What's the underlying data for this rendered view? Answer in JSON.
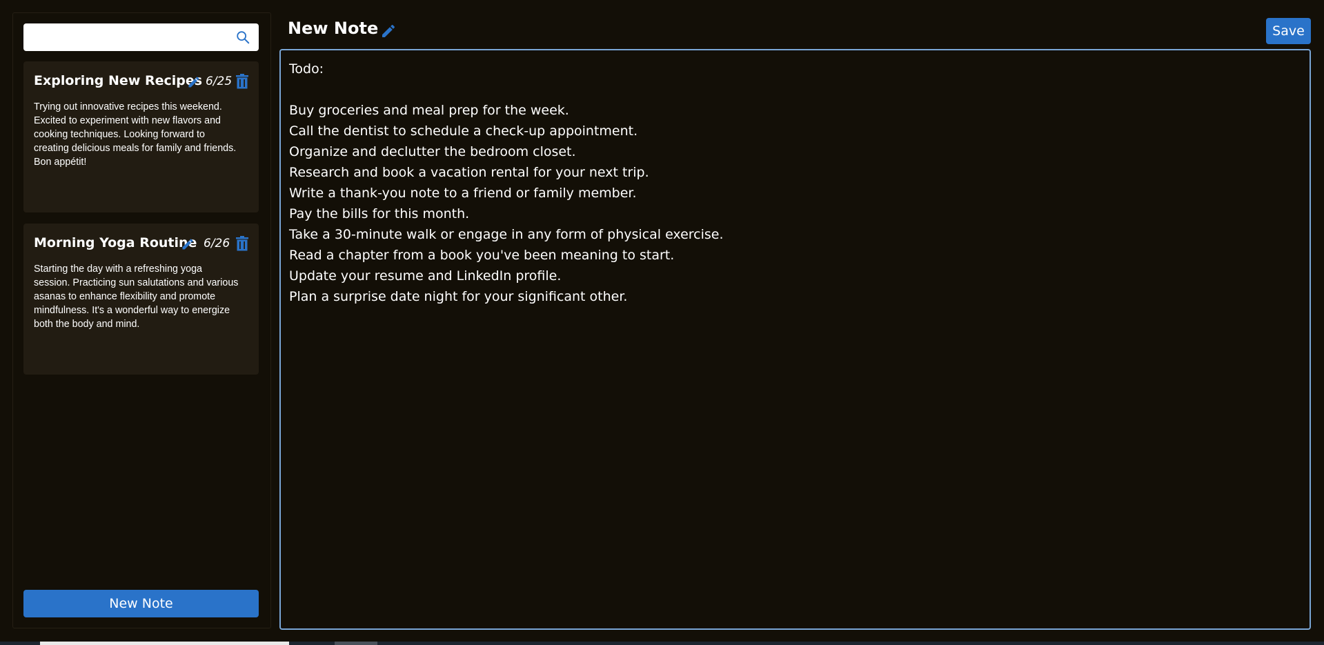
{
  "colors": {
    "background": "#130f07",
    "card": "#221c12",
    "accent": "#2a73c9",
    "editor_border": "#7aa6d6"
  },
  "sidebar": {
    "search": {
      "value": "",
      "placeholder": "",
      "icon": "search-icon"
    },
    "notes": [
      {
        "title": "Exploring New Recipes",
        "date": "6/25",
        "body": "Trying out innovative recipes this weekend. Excited to experiment with new flavors and cooking techniques. Looking forward to creating delicious meals for family and friends. Bon appétit!"
      },
      {
        "title": "Morning Yoga Routine",
        "date": "6/26",
        "body": "Starting the day with a refreshing yoga session. Practicing sun salutations and various asanas to enhance flexibility and promote mindfulness. It's a wonderful way to energize both the body and mind."
      }
    ],
    "new_note_label": "New Note"
  },
  "editor": {
    "title": "New Note",
    "save_label": "Save",
    "content": "Todo:\n\nBuy groceries and meal prep for the week.\nCall the dentist to schedule a check-up appointment.\nOrganize and declutter the bedroom closet.\nResearch and book a vacation rental for your next trip.\nWrite a thank-you note to a friend or family member.\nPay the bills for this month.\nTake a 30-minute walk or engage in any form of physical exercise.\nRead a chapter from a book you've been meaning to start.\nUpdate your resume and LinkedIn profile.\nPlan a surprise date night for your significant other."
  }
}
